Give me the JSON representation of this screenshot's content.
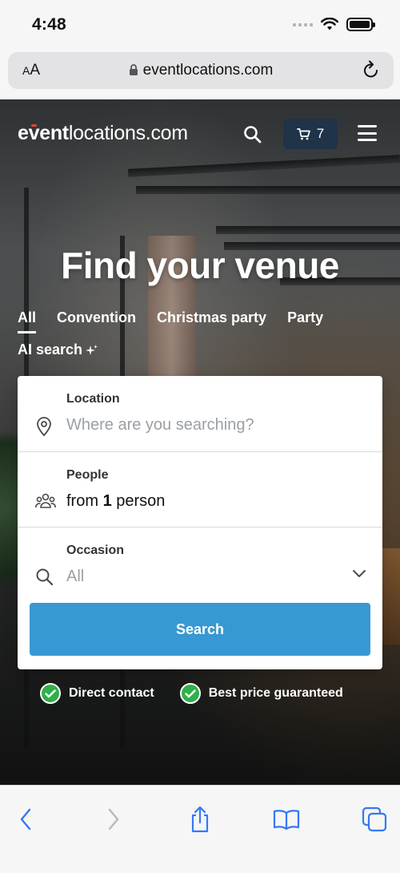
{
  "status_bar": {
    "time": "4:48"
  },
  "browser": {
    "aa_label_small": "A",
    "aa_label_large": "A",
    "url": "eventlocations.com"
  },
  "site": {
    "logo": {
      "part1": "e",
      "part2": "v",
      "part3": "ent",
      "part4": "locations.com"
    },
    "cart_count": "7",
    "hero_title": "Find your venue",
    "tabs": [
      {
        "label": "All",
        "active": true
      },
      {
        "label": "Convention",
        "active": false
      },
      {
        "label": "Christmas party",
        "active": false
      },
      {
        "label": "Party",
        "active": false
      }
    ],
    "ai_search_label": "AI search",
    "search_form": {
      "location": {
        "label": "Location",
        "placeholder": "Where are you searching?"
      },
      "people": {
        "label": "People",
        "prefix": "from ",
        "count": "1",
        "suffix": " person"
      },
      "occasion": {
        "label": "Occasion",
        "value": "All"
      },
      "submit_label": "Search"
    },
    "badges": [
      {
        "label": "Direct contact"
      },
      {
        "label": "Best price guaranteed"
      }
    ]
  },
  "colors": {
    "accent": "#3898d3",
    "cart_bg": "#1f3349",
    "check": "#2fb04a",
    "logo_accent": "#e8403a",
    "toolbar_icon": "#3478f6"
  }
}
